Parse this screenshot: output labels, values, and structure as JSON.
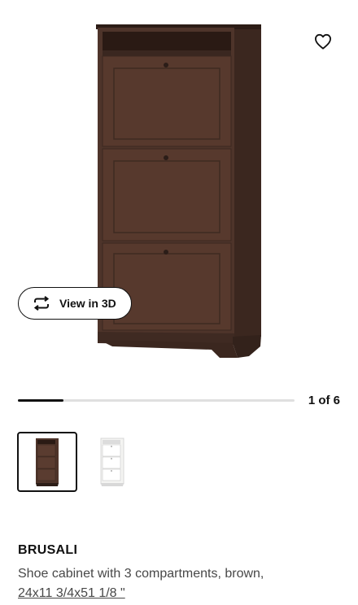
{
  "gallery": {
    "view3d_label": "View in 3D",
    "counter": "1 of 6",
    "progress_fraction": 0.165,
    "thumbnails": [
      {
        "variant": "brown",
        "selected": true
      },
      {
        "variant": "white",
        "selected": false
      }
    ]
  },
  "product": {
    "name": "BRUSALI",
    "description": "Shoe cabinet with 3 compartments, brown,",
    "dimensions": "24x11 3/4x51 1/8 \""
  },
  "icons": {
    "favorite": "heart-icon",
    "view3d": "rotate-arrows-icon"
  },
  "colors": {
    "cabinet_brown": "#4a3127",
    "text": "#111111",
    "text_muted": "#484848",
    "progress_track": "#dfdfdf",
    "progress_fill": "#111111"
  }
}
